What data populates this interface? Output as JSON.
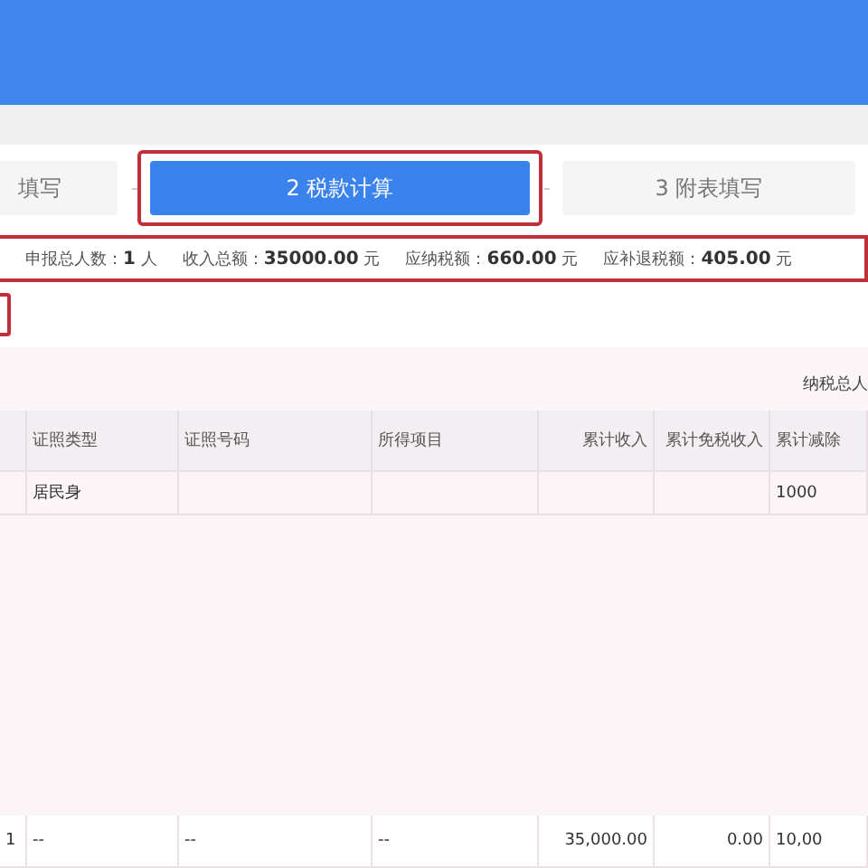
{
  "steps": [
    {
      "label": "填写",
      "selected": false,
      "highlighted": false
    },
    {
      "label": "2 税款计算",
      "selected": true,
      "highlighted": true
    },
    {
      "label": "3 附表填写",
      "selected": false,
      "highlighted": false
    }
  ],
  "summary": {
    "highlighted": true,
    "items": [
      {
        "label": "申报总人数：",
        "value": "1",
        "unit": "人"
      },
      {
        "label": "收入总额：",
        "value": "35000.00",
        "unit": "元"
      },
      {
        "label": "应纳税额：",
        "value": "660.00",
        "unit": "元"
      },
      {
        "label": "应补退税额：",
        "value": "405.00",
        "unit": "元"
      }
    ]
  },
  "table": {
    "caption": "纳税总人",
    "columns": [
      "",
      "证照类型",
      "证照号码",
      "所得项目",
      "累计收入",
      "累计免税收入",
      "累计减除"
    ],
    "rows": [
      [
        "",
        "居民身",
        "",
        "",
        "",
        "",
        "1000"
      ]
    ],
    "footer": [
      "1",
      "--",
      "--",
      "--",
      "35,000.00",
      "0.00",
      "10,00"
    ]
  }
}
